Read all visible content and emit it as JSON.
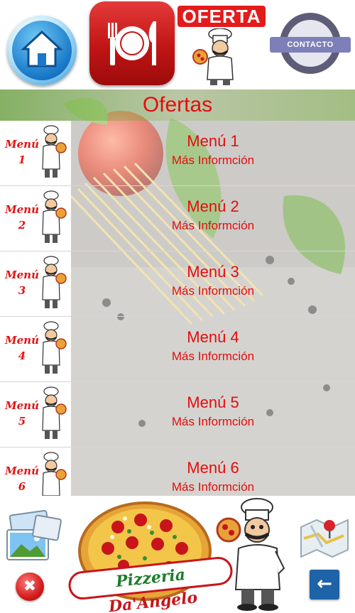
{
  "topbar": {
    "home_icon": "home-icon",
    "menu_icon": "plate-fork-knife-icon",
    "oferta_label": "OFERTA",
    "contacto_label": "CONTACTO"
  },
  "content": {
    "title": "Ofertas",
    "menus": [
      {
        "thumb_label": "Menú 1",
        "title": "Menú 1",
        "subtitle": "Más Informción"
      },
      {
        "thumb_label": "Menú 2",
        "title": "Menú 2",
        "subtitle": "Más Informción"
      },
      {
        "thumb_label": "Menú 3",
        "title": "Menú 3",
        "subtitle": "Más Informción"
      },
      {
        "thumb_label": "Menú 4",
        "title": "Menú 4",
        "subtitle": "Más Informción"
      },
      {
        "thumb_label": "Menú 5",
        "title": "Menú 5",
        "subtitle": "Más Informción"
      },
      {
        "thumb_label": "Menú 6",
        "title": "Menú 6",
        "subtitle": "Más Informción"
      }
    ]
  },
  "footer": {
    "gallery_icon": "photo-gallery-icon",
    "close_icon": "close-icon",
    "close_glyph": "✖",
    "logo_text_a": "Pizzeria",
    "logo_text_b": "Da'Angelo",
    "map_icon": "map-pin-icon",
    "back_icon": "back-arrow-icon",
    "back_glyph": "←"
  },
  "colors": {
    "accent_red": "#e30e0e",
    "title_green": "#78b450",
    "back_blue": "#1e62a8"
  }
}
